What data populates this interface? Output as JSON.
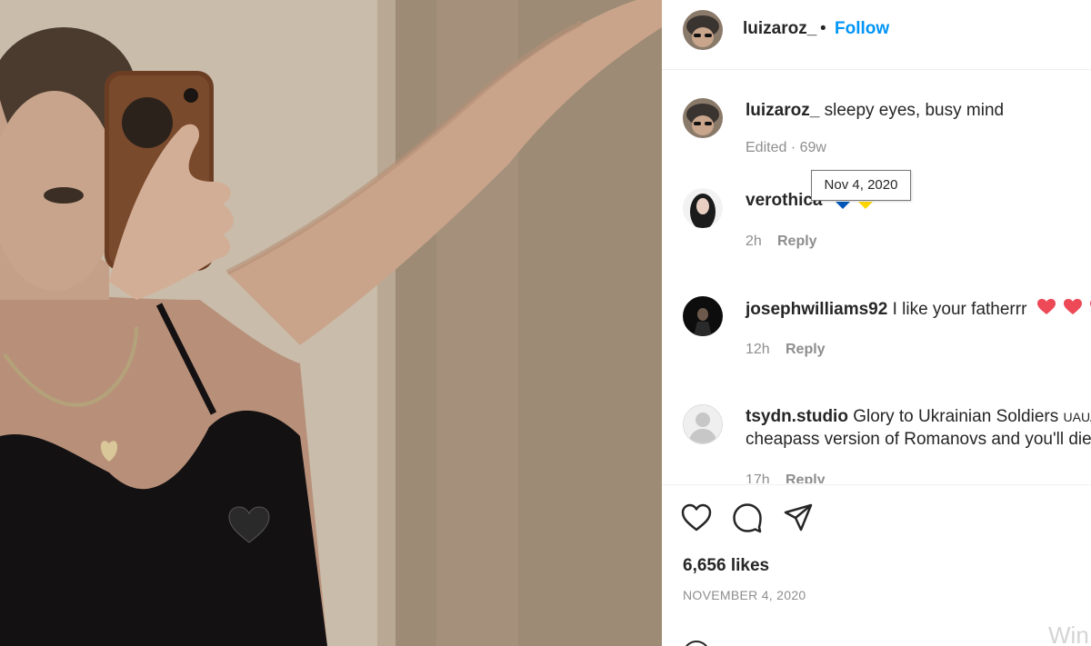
{
  "post": {
    "author": "luizaroz_",
    "follow_label": "Follow",
    "separator": "•",
    "caption": {
      "username": "luizaroz_",
      "text": "sleepy eyes, busy mind",
      "meta": "Edited · 69w"
    },
    "tooltip": "Nov 4, 2020",
    "comments": [
      {
        "username": "verothica",
        "text": "",
        "time": "2h",
        "reply_label": "Reply"
      },
      {
        "username": "josephwilliams92",
        "text": "I like your fatherrr",
        "time": "12h",
        "reply_label": "Reply"
      },
      {
        "username": "tsydn.studio",
        "text": "Glory to Ukrainian Soldiers",
        "text_suffix": "UAUA",
        "text_line2": "cheapass version of Romanovs and you'll die",
        "time": "17h",
        "reply_label": "Reply"
      }
    ],
    "likes": "6,656 likes",
    "date": "NOVEMBER 4, 2020"
  },
  "icons": {
    "like": "heart-outline-icon",
    "comment": "speech-bubble-icon",
    "share": "paper-plane-icon",
    "photo_sticker": "black-heart-icon"
  },
  "colors": {
    "follow": "#0095f6",
    "heart": "#ed4956",
    "flag_blue": "#0057b7",
    "flag_yellow": "#ffd700"
  },
  "watermark": "Win"
}
